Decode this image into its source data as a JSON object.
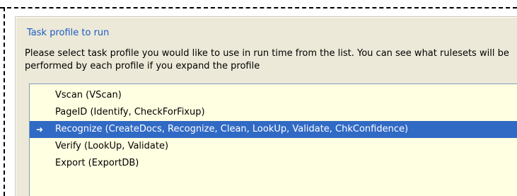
{
  "colors": {
    "section_title": "#1c5cc6",
    "panel_bg": "#ece9d8",
    "list_bg": "#ffffe1",
    "selection_bg": "#316ac5",
    "selection_text": "#ffffff"
  },
  "section": {
    "title": "Task profile to run",
    "description": "Please select task profile you would like to use in run time from the list. You can see what rulesets will be performed by each profile if you expand the profile"
  },
  "profiles": [
    {
      "label": "Vscan  (VScan)",
      "selected": false,
      "indicator": ""
    },
    {
      "label": "PageID  (Identify, CheckForFixup)",
      "selected": false,
      "indicator": ""
    },
    {
      "label": "Recognize  (CreateDocs, Recognize, Clean, LookUp, Validate, ChkConfidence)",
      "selected": true,
      "indicator": "➜",
      "indicator_icon": "arrow-right-icon"
    },
    {
      "label": "Verify  (LookUp, Validate)",
      "selected": false,
      "indicator": ""
    },
    {
      "label": "Export  (ExportDB)",
      "selected": false,
      "indicator": ""
    }
  ]
}
